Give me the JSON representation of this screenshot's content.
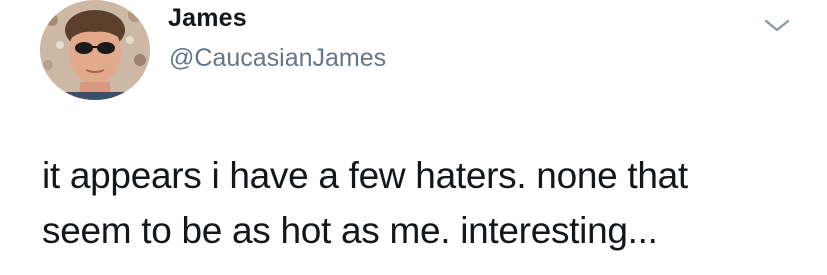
{
  "author": {
    "name": "James",
    "handle": "@CaucasianJames",
    "avatar_icon": "profile-photo"
  },
  "tweet": {
    "text": "it appears i have a few haters. none that\nseem to be as hot as me. interesting..."
  },
  "menu": {
    "icon": "chevron-down-icon"
  },
  "colors": {
    "name": "#14171a",
    "handle": "#657786",
    "chevron": "#8899a6",
    "background": "#ffffff"
  }
}
